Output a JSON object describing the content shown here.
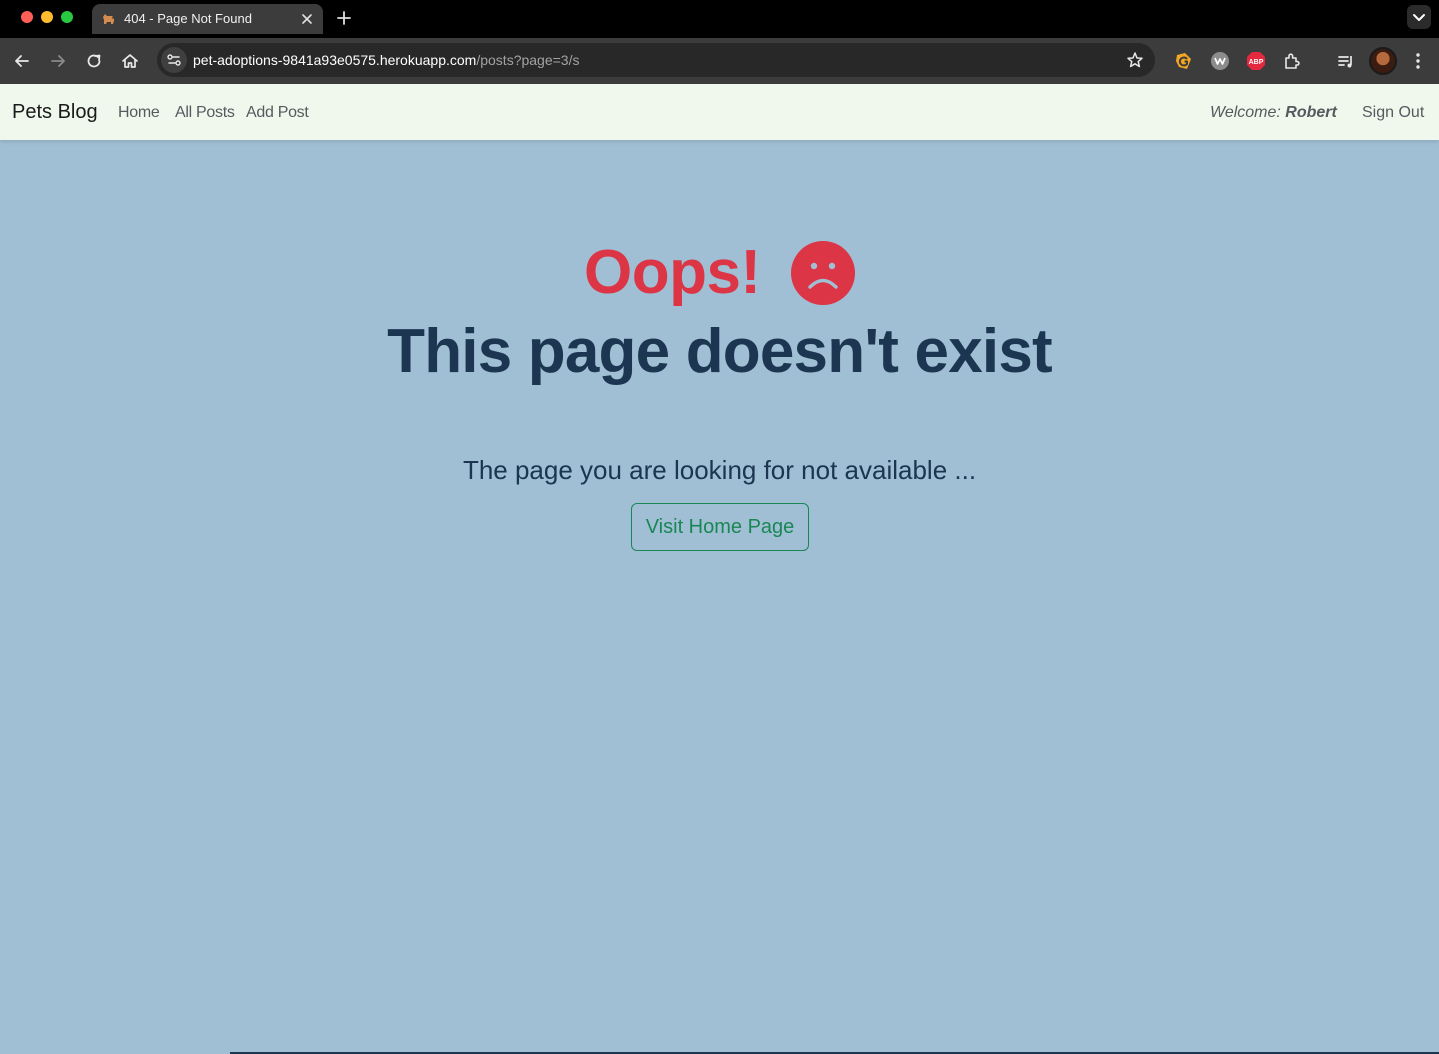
{
  "browser": {
    "tab": {
      "title": "404 - Page Not Found"
    },
    "url": {
      "host": "pet-adoptions-9841a93e0575.herokuapp.com",
      "path": "/posts?page=3/s"
    },
    "extensions": [
      "grammarly-icon",
      "wappalyzer-icon",
      "adblock-plus-icon",
      "extensions-puzzle-icon",
      "media-queue-icon"
    ],
    "abp_label": "ABP"
  },
  "navbar": {
    "brand": "Pets Blog",
    "links": [
      "Home",
      "All Posts",
      "Add Post"
    ],
    "welcome_prefix": "Welcome:",
    "user_name": "Robert",
    "signout": "Sign Out"
  },
  "error": {
    "oops": "Oops!",
    "headline": "This page doesn't exist",
    "message": "The page you are looking for not available ...",
    "button": "Visit Home Page"
  },
  "colors": {
    "page_bg": "#a0bfd5",
    "navbar_bg": "#f0f8ee",
    "danger": "#dc3545",
    "headline": "#1c3550",
    "button": "#198754"
  }
}
